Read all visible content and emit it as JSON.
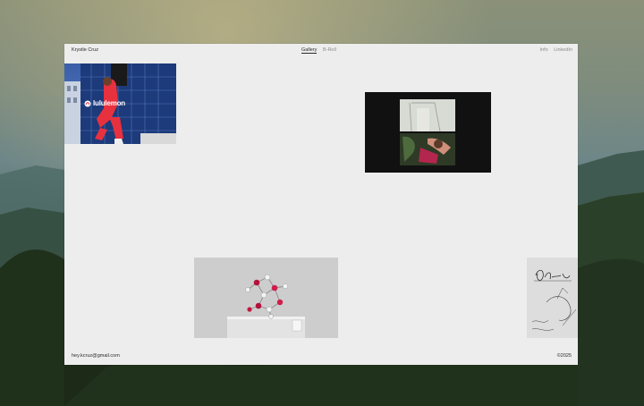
{
  "site": {
    "name": "Krystle Cruz",
    "nav": [
      {
        "label": "Gallery",
        "active": true
      },
      {
        "label": "B-Roll",
        "active": false
      }
    ],
    "links": [
      {
        "label": "Info"
      },
      {
        "label": "LinkedIn"
      }
    ]
  },
  "gallery": {
    "tiles": [
      {
        "name": "lululemon-campaign",
        "logo_text": "lululemon"
      },
      {
        "name": "split-video-frame"
      },
      {
        "name": "molecule-sculpture"
      },
      {
        "name": "signature-sketch"
      }
    ]
  },
  "footer": {
    "email": "hey.kcruz@gmail.com",
    "copyright": "©2025"
  },
  "colors": {
    "window_bg": "#ededed",
    "text": "#2a2a2a",
    "muted": "#8b8b8b",
    "brand_logo": "#ffffff"
  }
}
